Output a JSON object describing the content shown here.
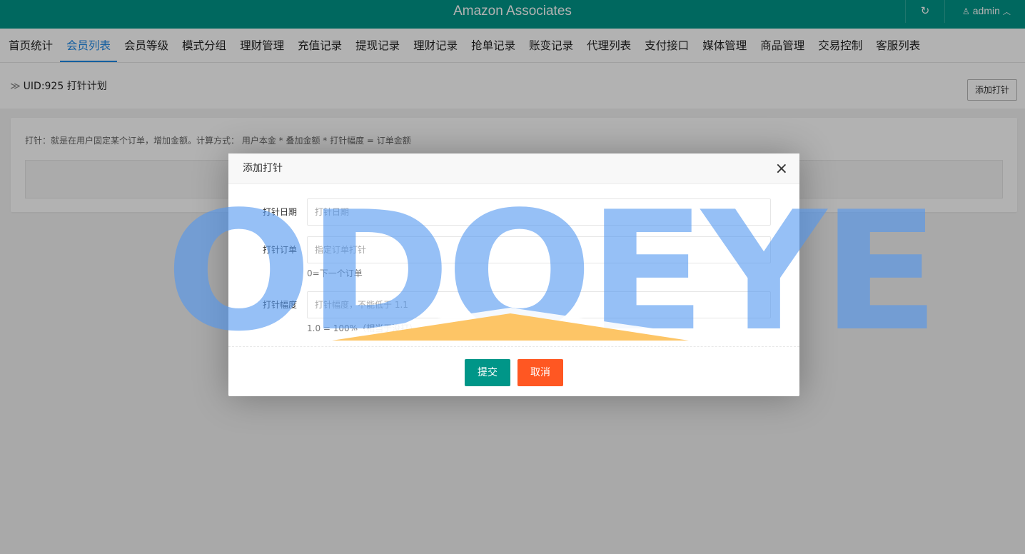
{
  "header": {
    "title": "Amazon Associates",
    "refresh_icon": "refresh-icon",
    "user_name": "admin",
    "user_icon": "user-icon",
    "user_glyph": "♙",
    "chevron_glyph": "︿",
    "refresh_glyph": "↻"
  },
  "nav": {
    "tabs": [
      {
        "label": "首页统计",
        "active": false
      },
      {
        "label": "会员列表",
        "active": true
      },
      {
        "label": "会员等级",
        "active": false
      },
      {
        "label": "模式分组",
        "active": false
      },
      {
        "label": "理财管理",
        "active": false
      },
      {
        "label": "充值记录",
        "active": false
      },
      {
        "label": "提现记录",
        "active": false
      },
      {
        "label": "理财记录",
        "active": false
      },
      {
        "label": "抢单记录",
        "active": false
      },
      {
        "label": "账变记录",
        "active": false
      },
      {
        "label": "代理列表",
        "active": false
      },
      {
        "label": "支付接口",
        "active": false
      },
      {
        "label": "媒体管理",
        "active": false
      },
      {
        "label": "商品管理",
        "active": false
      },
      {
        "label": "交易控制",
        "active": false
      },
      {
        "label": "客服列表",
        "active": false
      }
    ]
  },
  "breadcrumb": {
    "arrow": "≫",
    "text": "UID:925 打针计划",
    "add_button": "添加打针"
  },
  "panel": {
    "description": "打针：就是在用户固定某个订单，增加金额。计算方式： 用户本金 * 叠加金额 * 打针幅度 = 订单金额"
  },
  "modal": {
    "title": "添加打针",
    "close_glyph": "×",
    "fields": [
      {
        "label": "打针日期",
        "placeholder": "打针日期",
        "value": "",
        "hint": ""
      },
      {
        "label": "打针订单",
        "placeholder": "指定订单打针",
        "value": "",
        "hint": "0=下一个订单"
      },
      {
        "label": "打针幅度",
        "placeholder": "打针幅度，不能低于 1.1",
        "value": "",
        "hint": "1.0 = 100%（相当于没打）"
      }
    ],
    "submit": "提交",
    "cancel": "取消"
  },
  "watermark": {
    "text": "ODOEYE"
  },
  "colors": {
    "primary": "#009688",
    "danger": "#ff5722",
    "active_tab": "#1e88e5"
  }
}
